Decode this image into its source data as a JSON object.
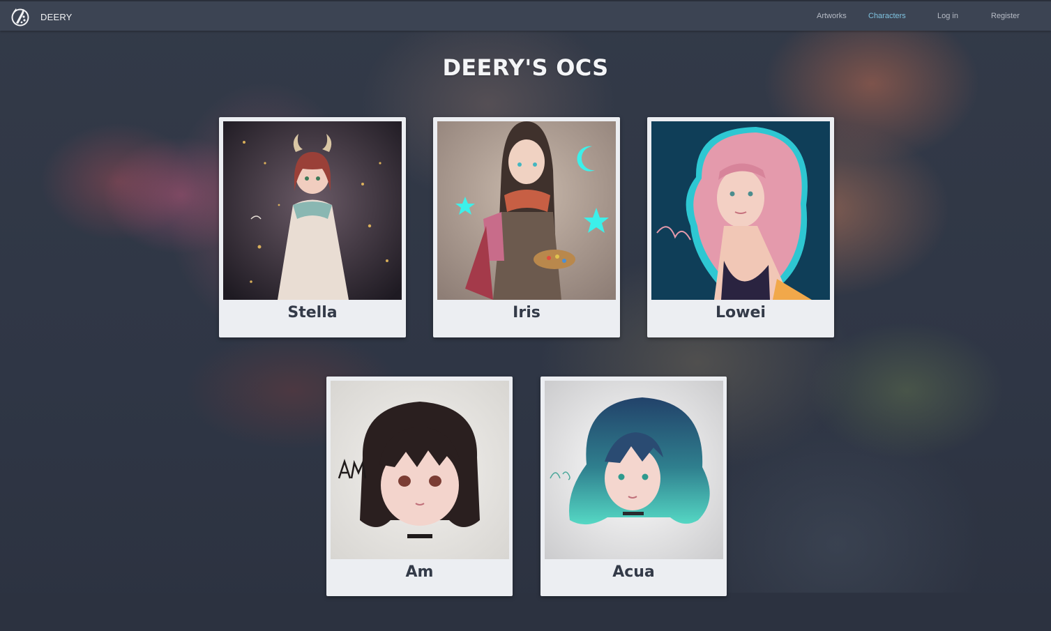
{
  "navbar": {
    "brand": "DEERY",
    "links": [
      {
        "label": "Artworks",
        "active": false
      },
      {
        "label": "Characters",
        "active": true
      },
      {
        "label": "Log in",
        "active": false
      },
      {
        "label": "Register",
        "active": false
      }
    ],
    "active_color": "#7fc3e0"
  },
  "page": {
    "title": "DEERY'S OCS"
  },
  "characters": [
    {
      "name": "Stella",
      "signature": "Stella"
    },
    {
      "name": "Iris"
    },
    {
      "name": "Lowei",
      "signature": "lowei"
    },
    {
      "name": "Am",
      "signature": "AM"
    },
    {
      "name": "Acua",
      "signature": "Acua"
    }
  ],
  "colors": {
    "navbar": "#3c4453",
    "background": "#2c3240",
    "card": "#eceef2",
    "card_text": "#333a48"
  },
  "icons": {
    "brand": "deer-palette-logo-icon"
  }
}
